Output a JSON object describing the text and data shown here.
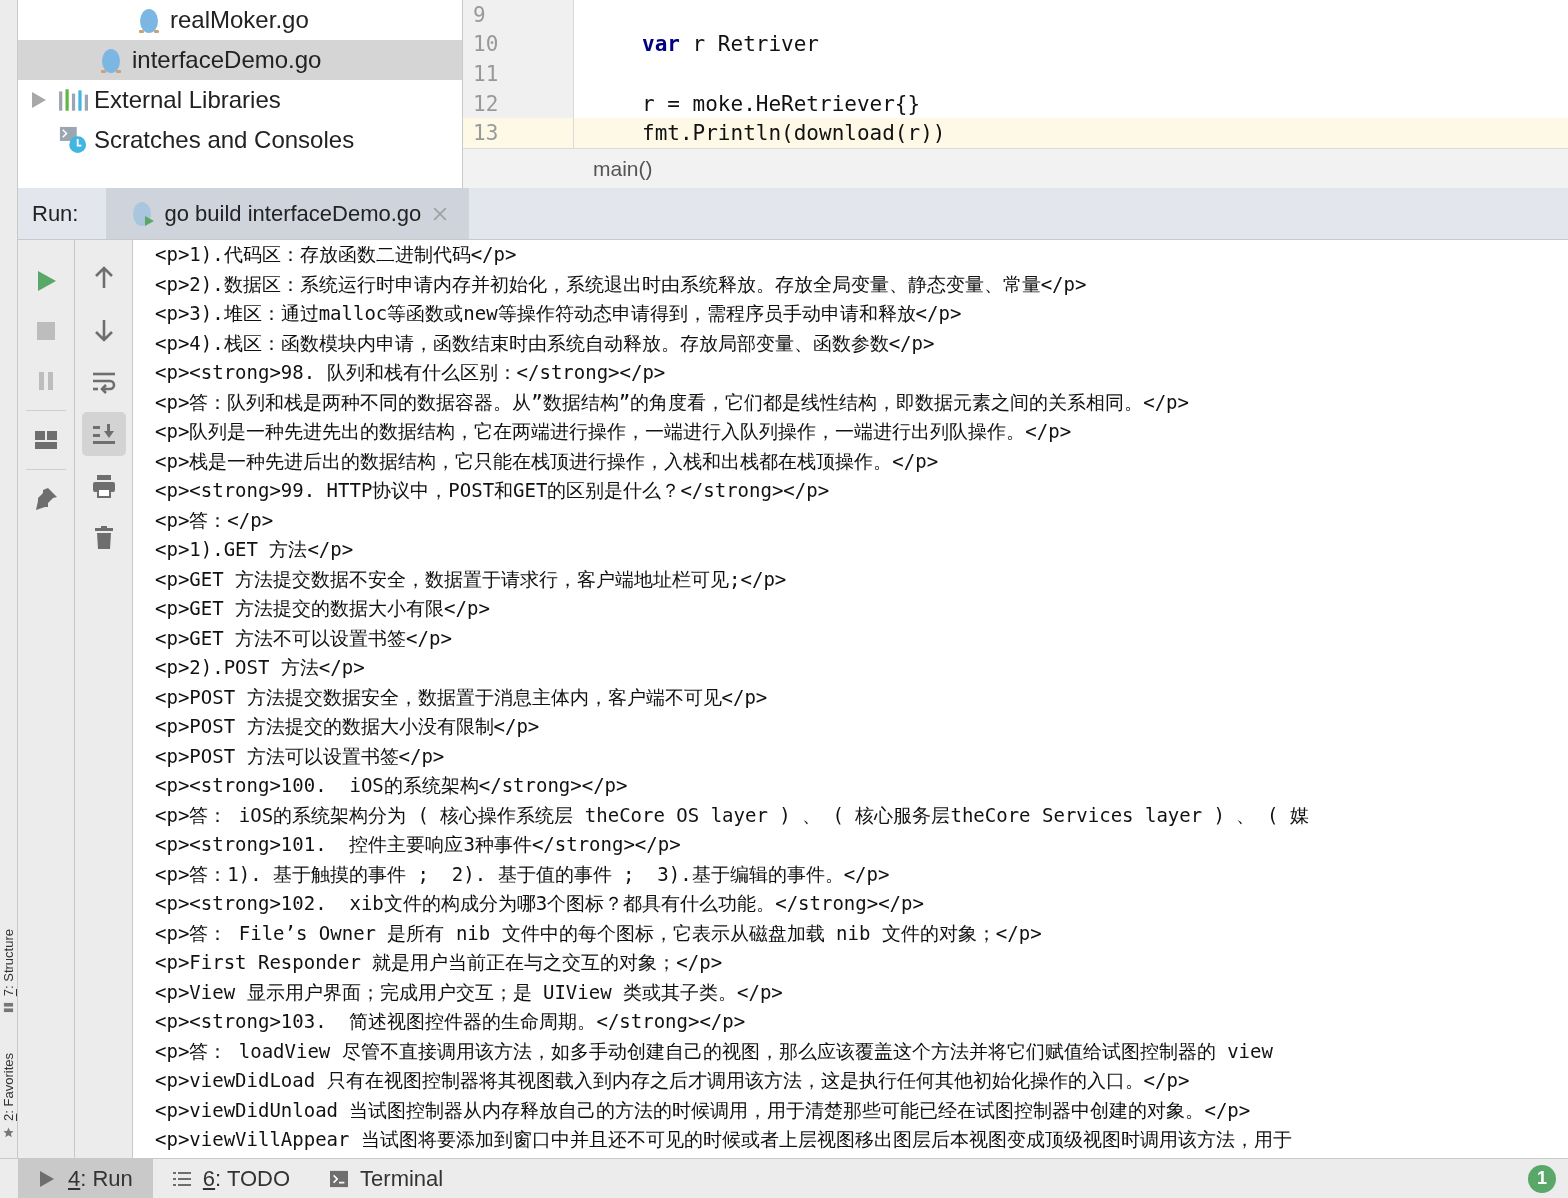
{
  "side_tabs": [
    {
      "mnemonic": "7",
      "label": ": Structure",
      "kind": "structure"
    },
    {
      "mnemonic": "2",
      "label": ": Favorites",
      "kind": "favorites"
    }
  ],
  "project_tree": [
    {
      "children": [
        {
          "children": [
            {
              "label": "realMoker.go",
              "kind": "gofile",
              "selected": false
            }
          ]
        },
        {
          "label": "interfaceDemo.go",
          "kind": "gofile",
          "selected": true
        }
      ]
    },
    {
      "label": "External Libraries",
      "kind": "libraries",
      "selected": false,
      "expanded": false
    },
    {
      "label": "Scratches and Consoles",
      "kind": "scratches",
      "selected": false
    }
  ],
  "editor": {
    "lines": [
      {
        "number": "9",
        "current": false
      },
      {
        "number": "10",
        "current": false,
        "tokens": [
          {
            "kind": "keyword",
            "text": "var"
          },
          {
            "kind": "plain",
            "text": " r Retriver"
          }
        ]
      },
      {
        "number": "11",
        "current": false
      },
      {
        "number": "12",
        "current": false,
        "tokens": [
          {
            "kind": "plain",
            "text": "r = moke.HeRetriever{}"
          }
        ]
      },
      {
        "number": "13",
        "current": true,
        "tokens": [
          {
            "kind": "plain",
            "text": "fmt.Println(download(r))"
          }
        ]
      }
    ],
    "breadcrumb": "main()"
  },
  "run_panel": {
    "label": "Run:",
    "tab": {
      "title": "go build interfaceDemo.go",
      "selected": true
    },
    "toolbar_left": [
      {
        "kind": "run",
        "disabled": false
      },
      {
        "kind": "stop",
        "disabled": true
      },
      {
        "kind": "pause",
        "disabled": true
      },
      {
        "kind": "separator"
      },
      {
        "kind": "layout",
        "disabled": false
      },
      {
        "kind": "separator"
      },
      {
        "kind": "pin",
        "disabled": false
      }
    ],
    "toolbar_right": [
      {
        "kind": "up",
        "selected": false
      },
      {
        "kind": "down",
        "selected": false
      },
      {
        "kind": "wrap",
        "selected": false
      },
      {
        "kind": "scroll-end",
        "selected": true
      },
      {
        "kind": "print",
        "selected": false
      },
      {
        "kind": "trash",
        "selected": false
      }
    ],
    "console": [
      "<p>1).代码区：存放函数二进制代码</p>",
      "<p>2).数据区：系统运行时申请内存并初始化，系统退出时由系统释放。存放全局变量、静态变量、常量</p>",
      "<p>3).堆区：通过malloc等函数或new等操作符动态申请得到，需程序员手动申请和释放</p>",
      "<p>4).栈区：函数模块内申请，函数结束时由系统自动释放。存放局部变量、函数参数</p>",
      "<p><strong>98. 队列和栈有什么区别：</strong></p>",
      "<p>答：队列和栈是两种不同的数据容器。从”数据结构”的角度看，它们都是线性结构，即数据元素之间的关系相同。</p>",
      "<p>队列是一种先进先出的数据结构，它在两端进行操作，一端进行入队列操作，一端进行出列队操作。</p>",
      "<p>栈是一种先进后出的数据结构，它只能在栈顶进行操作，入栈和出栈都在栈顶操作。</p>",
      "<p><strong>99. HTTP协议中，POST和GET的区别是什么？</strong></p>",
      "<p>答：</p>",
      "<p>1).GET 方法</p>",
      "<p>GET 方法提交数据不安全，数据置于请求行，客户端地址栏可见;</p>",
      "<p>GET 方法提交的数据大小有限</p>",
      "<p>GET 方法不可以设置书签</p>",
      "<p>2).POST 方法</p>",
      "<p>POST 方法提交数据安全，数据置于消息主体内，客户端不可见</p>",
      "<p>POST 方法提交的数据大小没有限制</p>",
      "<p>POST 方法可以设置书签</p>",
      "<p><strong>100.  iOS的系统架构</strong></p>",
      "<p>答： iOS的系统架构分为 ( 核心操作系统层 theCore OS layer ) 、 ( 核心服务层theCore Services layer ) 、 ( 媒",
      "<p><strong>101.  控件主要响应3种事件</strong></p>",
      "<p>答：1). 基于触摸的事件 ;  2). 基于值的事件 ;  3).基于编辑的事件。</p>",
      "<p><strong>102.  xib文件的构成分为哪3个图标？都具有什么功能。</strong></p>",
      "<p>答： File’s Owner 是所有 nib 文件中的每个图标，它表示从磁盘加载 nib 文件的对象；</p>",
      "<p>First Responder 就是用户当前正在与之交互的对象；</p>",
      "<p>View 显示用户界面；完成用户交互；是 UIView 类或其子类。</p>",
      "<p><strong>103.  简述视图控件器的生命周期。</strong></p>",
      "<p>答： loadView 尽管不直接调用该方法，如多手动创建自己的视图，那么应该覆盖这个方法并将它们赋值给试图控制器的 view",
      "<p>viewDidLoad 只有在视图控制器将其视图载入到内存之后才调用该方法，这是执行任何其他初始化操作的入口。</p>",
      "<p>viewDidUnload 当试图控制器从内存释放自己的方法的时候调用，用于清楚那些可能已经在试图控制器中创建的对象。</p>",
      "<p>viewVillAppear 当试图将要添加到窗口中并且还不可见的时候或者上层视图移出图层后本视图变成顶级视图时调用该方法，用于"
    ]
  },
  "bottom_tabs": [
    {
      "mnemonic": "4",
      "label": ": Run",
      "kind": "run",
      "selected": true
    },
    {
      "mnemonic": "6",
      "label": ": TODO",
      "kind": "todo",
      "selected": false
    },
    {
      "label": "Terminal",
      "kind": "terminal",
      "selected": false
    }
  ],
  "status_badge": "1"
}
